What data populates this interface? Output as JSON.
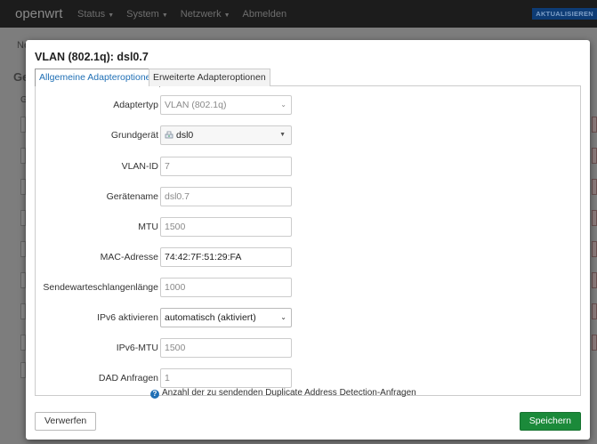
{
  "navbar": {
    "brand": "openwrt",
    "menu": [
      {
        "label": "Status"
      },
      {
        "label": "System"
      },
      {
        "label": "Netzwerk"
      },
      {
        "label": "Abmelden"
      }
    ],
    "unsaved_badge": "AKTUALISIEREN"
  },
  "background": {
    "breadcrumb_fragment": "Ne",
    "heading_fragment": "Ge",
    "subheading_fragment": "G"
  },
  "modal": {
    "title": "VLAN (802.1q): dsl0.7",
    "tabs": [
      {
        "label": "Allgemeine Adapteroptionen",
        "active": true
      },
      {
        "label": "Erweiterte Adapteroptionen",
        "active": false
      }
    ],
    "fields": {
      "adaptertyp": {
        "label": "Adaptertyp",
        "value": "VLAN (802.1q)"
      },
      "grundgeraet": {
        "label": "Grundgerät",
        "value": "dsl0"
      },
      "vlan_id": {
        "label": "VLAN-ID",
        "value": "7"
      },
      "geraetename": {
        "label": "Gerätename",
        "value": "dsl0.7"
      },
      "mtu": {
        "label": "MTU",
        "placeholder": "1500"
      },
      "mac": {
        "label": "MAC-Adresse",
        "value": "74:42:7F:51:29:FA"
      },
      "queue": {
        "label": "Sendewarteschlangenlänge",
        "placeholder": "1000"
      },
      "ipv6": {
        "label": "IPv6 aktivieren",
        "value": "automatisch (aktiviert)"
      },
      "ipv6_mtu": {
        "label": "IPv6-MTU",
        "placeholder": "1500"
      },
      "dad": {
        "label": "DAD Anfragen",
        "placeholder": "1"
      }
    },
    "dad_help": "Anzahl der zu sendenden Duplicate Address Detection-Anfragen",
    "buttons": {
      "dismiss": "Verwerfen",
      "save": "Speichern"
    }
  },
  "colors": {
    "accent": "#1f6fb5",
    "save": "#1b8a3a",
    "navbar": "#1c1c1c"
  }
}
